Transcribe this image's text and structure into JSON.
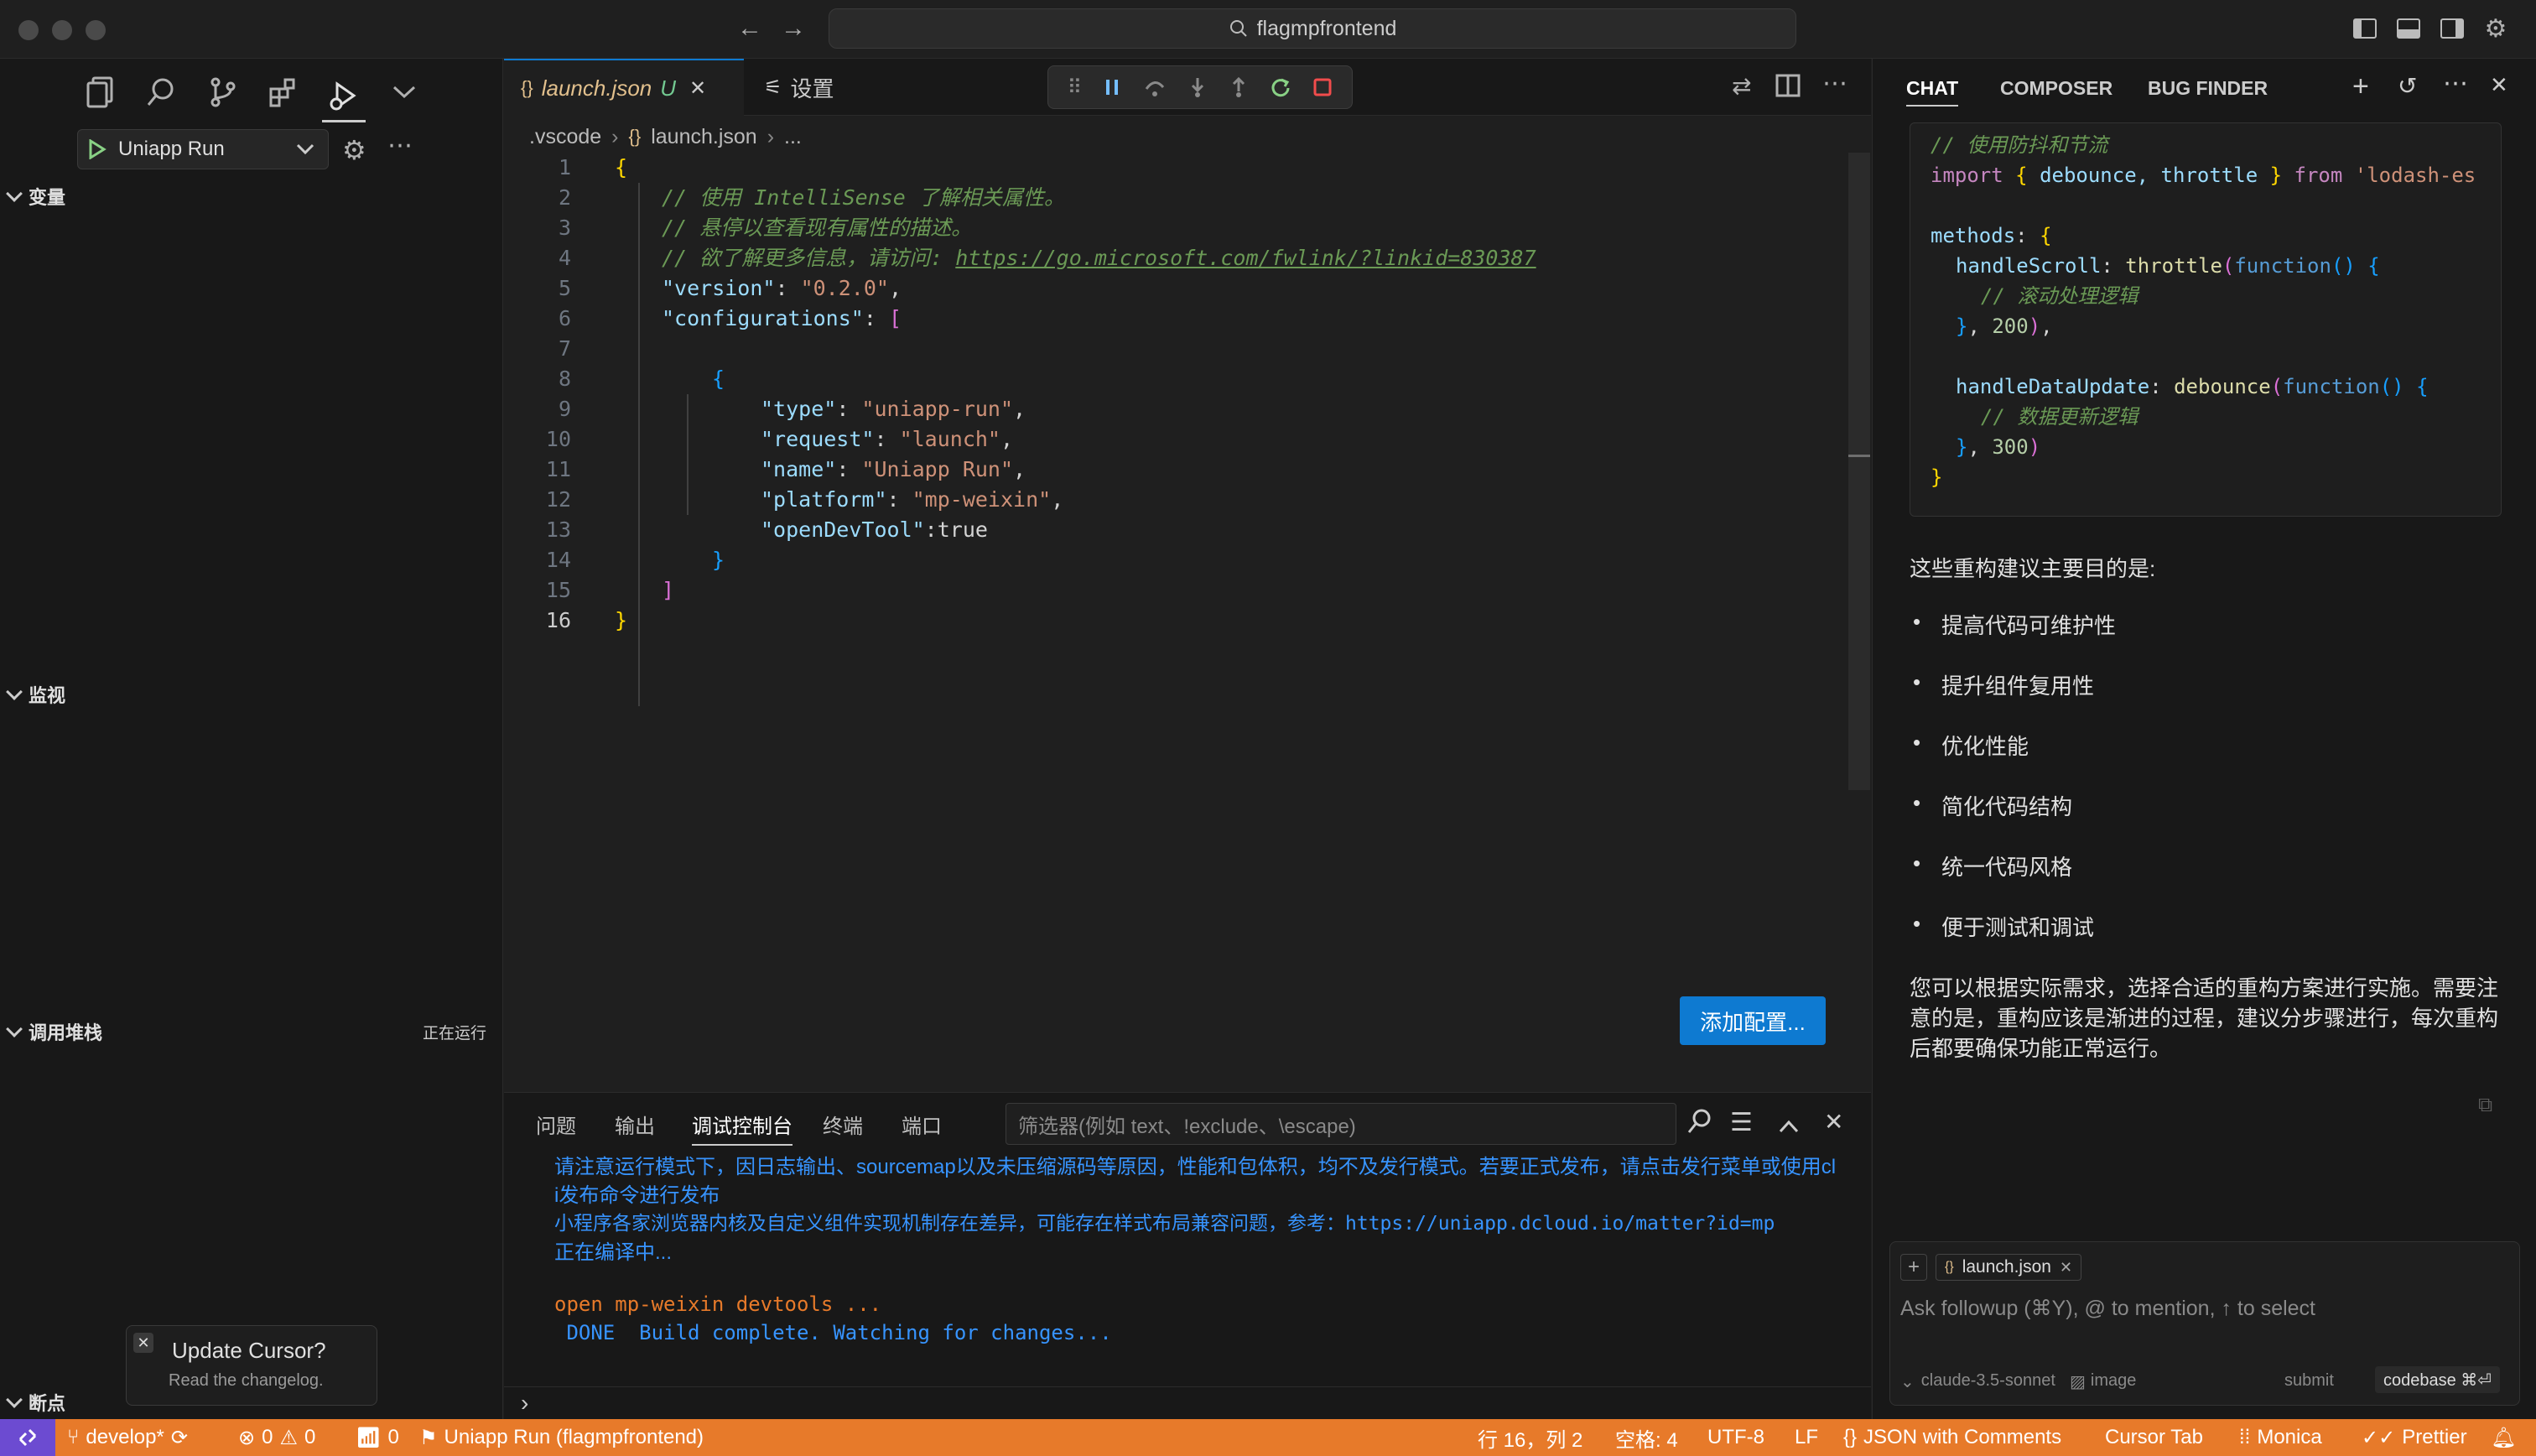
{
  "window": {
    "search_text": "flagmpfrontend"
  },
  "sidebar": {
    "run_config": "Uniapp Run",
    "sections": {
      "variables": "变量",
      "watch": "监视",
      "call_stack": "调用堆栈",
      "call_stack_status": "正在运行",
      "breakpoints": "断点"
    },
    "toast": {
      "title": "Update Cursor?",
      "subtitle": "Read the changelog."
    }
  },
  "editor": {
    "tabs": [
      {
        "label": "launch.json",
        "badge": "U"
      },
      {
        "label": "设置"
      }
    ],
    "breadcrumb": [
      ".vscode",
      "launch.json",
      "..."
    ],
    "line_numbers": [
      "1",
      "2",
      "3",
      "4",
      "5",
      "6",
      "7",
      "8",
      "9",
      "10",
      "11",
      "12",
      "13",
      "14",
      "15",
      "16"
    ],
    "code": {
      "l2": "// 使用 IntelliSense 了解相关属性。",
      "l3": "// 悬停以查看现有属性的描述。",
      "l4_prefix": "// 欲了解更多信息，请访问: ",
      "l4_link": "https://go.microsoft.com/fwlink/?linkid=830387",
      "version_key": "\"version\"",
      "version_val": "\"0.2.0\"",
      "configurations_key": "\"configurations\"",
      "type_key": "\"type\"",
      "type_val": "\"uniapp-run\"",
      "request_key": "\"request\"",
      "request_val": "\"launch\"",
      "name_key": "\"name\"",
      "name_val": "\"Uniapp Run\"",
      "platform_key": "\"platform\"",
      "platform_val": "\"mp-weixin\"",
      "devtool_key": "\"openDevTool\"",
      "devtool_val": "true"
    },
    "add_config_label": "添加配置..."
  },
  "panel": {
    "tabs": [
      "问题",
      "输出",
      "调试控制台",
      "终端",
      "端口"
    ],
    "active_tab": "调试控制台",
    "filter_placeholder": "筛选器(例如 text、!exclude、\\escape)",
    "console": [
      "请注意运行模式下，因日志输出、sourcemap以及未压缩源码等原因，性能和包体积，均不及发行模式。若要正式发布，请点击发行菜单或使用cl",
      "i发布命令进行发布",
      "小程序各家浏览器内核及自定义组件实现机制存在差异，可能存在样式布局兼容问题，参考：https://uniapp.dcloud.io/matter?id=mp",
      "正在编译中...",
      "open mp-weixin devtools ...",
      " DONE  Build complete. Watching for changes..."
    ]
  },
  "chat": {
    "tabs": [
      "CHAT",
      "COMPOSER",
      "BUG FINDER"
    ],
    "code": {
      "c1": "// 使用防抖和节流",
      "import_kw": "import",
      "import_names": "debounce, throttle",
      "from_kw": "from",
      "from_src": "'lodash-es",
      "methods": "methods",
      "handleScroll": "handleScroll",
      "throttle": "throttle",
      "function_kw": "function",
      "c2": "// 滚动处理逻辑",
      "n200": "200",
      "handleDataUpdate": "handleDataUpdate",
      "debounce": "debounce",
      "c3": "// 数据更新逻辑",
      "n300": "300"
    },
    "intro": "这些重构建议主要目的是:",
    "bullets": [
      "提高代码可维护性",
      "提升组件复用性",
      "优化性能",
      "简化代码结构",
      "统一代码风格",
      "便于测试和调试"
    ],
    "conclusion": [
      "您可以根据实际需求，选择合适的重构方案进行实施。需要注",
      "意的是，重构应该是渐进的过程，建议分步骤进行，每次重构",
      "后都要确保功能正常运行。"
    ],
    "composer": {
      "context_chip": "launch.json",
      "placeholder": "Ask followup (⌘Y), @ to mention, ↑ to select",
      "model": "claude-3.5-sonnet",
      "image_label": "image",
      "submit_label": "submit",
      "codebase_label": "codebase ⌘⏎"
    }
  },
  "statusbar": {
    "branch": "develop*",
    "errors": "0",
    "warnings": "0",
    "ports": "0",
    "run_target": "Uniapp Run (flagmpfrontend)",
    "position": "行 16，列 2",
    "spaces": "空格: 4",
    "encoding": "UTF-8",
    "eol": "LF",
    "language": "JSON with Comments",
    "cursor_tab": "Cursor Tab",
    "monica": "Monica",
    "prettier": "Prettier"
  },
  "colors": {
    "accent_blue": "#0e7ad1",
    "status_orange": "#e77a2a",
    "remote_purple": "#6c4bd1"
  }
}
